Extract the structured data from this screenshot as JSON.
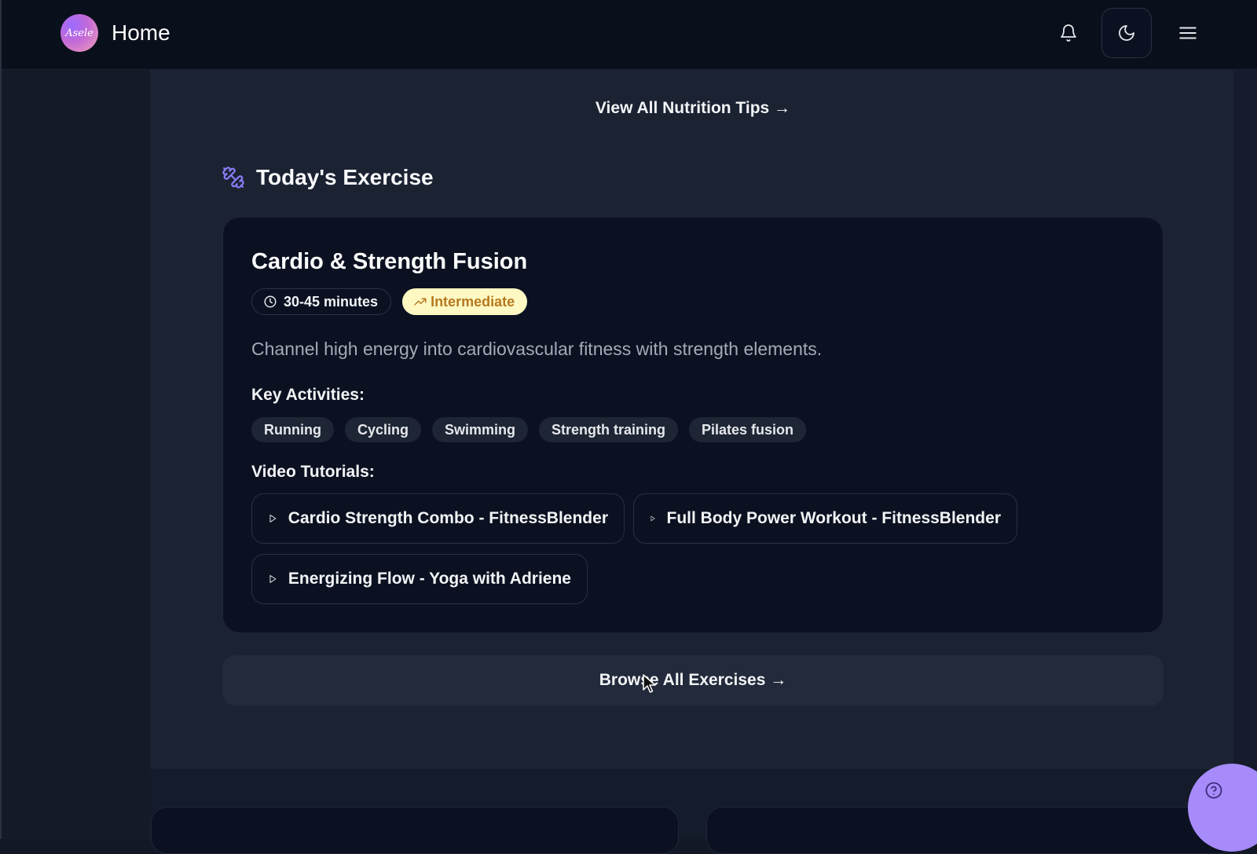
{
  "header": {
    "logo_text": "Asele",
    "title": "Home",
    "icons": {
      "notifications": "bell-icon",
      "theme": "moon-icon",
      "menu": "hamburger-icon"
    }
  },
  "nutrition": {
    "link_label": "View All Nutrition Tips →"
  },
  "exercise_section": {
    "icon": "dumbbell-icon",
    "title": "Today's Exercise",
    "card": {
      "title": "Cardio & Strength Fusion",
      "duration": "30-45 minutes",
      "level": "Intermediate",
      "description": "Channel high energy into cardiovascular fitness with strength elements.",
      "key_activities_label": "Key Activities:",
      "activities": [
        "Running",
        "Cycling",
        "Swimming",
        "Strength training",
        "Pilates fusion"
      ],
      "video_tutorials_label": "Video Tutorials:",
      "videos": [
        "Cardio Strength Combo - FitnessBlender",
        "Full Body Power Workout - FitnessBlender",
        "Energizing Flow - Yoga with Adriene"
      ]
    },
    "browse_label": "Browse All Exercises →"
  },
  "colors": {
    "accent": "#a78bfa",
    "level_badge_bg": "#fef9c3",
    "level_badge_text": "#b7791f",
    "card_bg": "#0b1121"
  },
  "help": {
    "icon": "help-icon"
  }
}
